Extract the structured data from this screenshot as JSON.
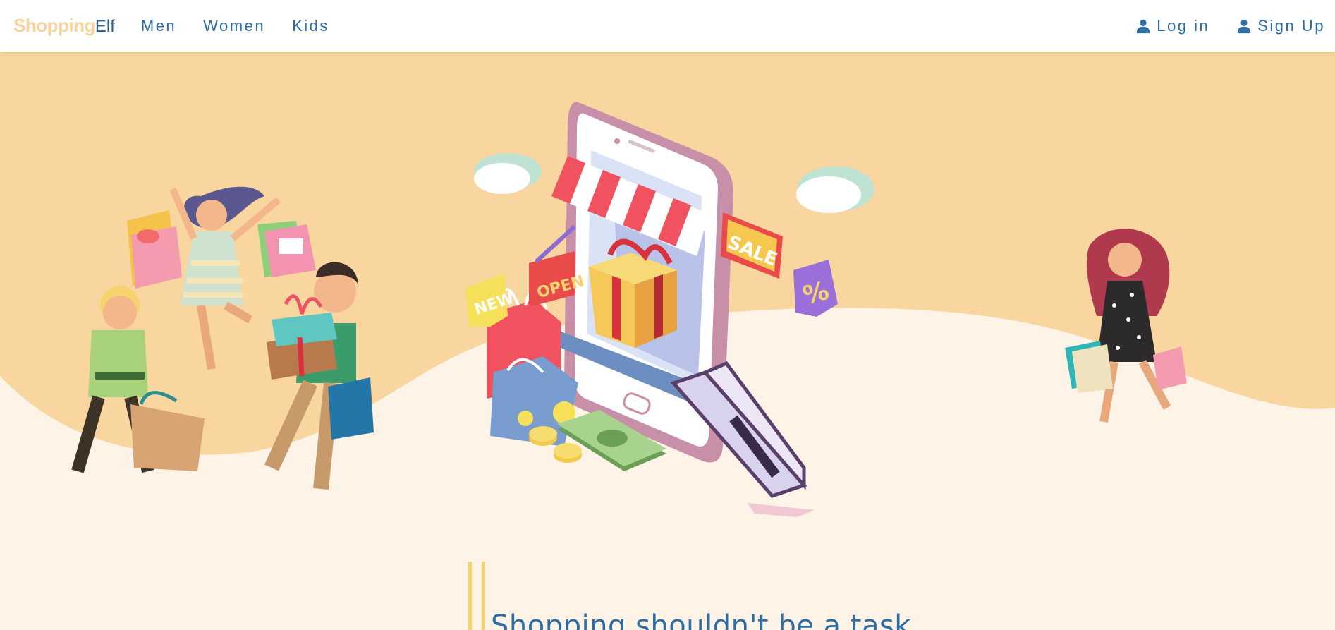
{
  "navbar": {
    "brand_primary": "Shopping",
    "brand_secondary": "Elf",
    "links": [
      {
        "label": "Men"
      },
      {
        "label": "Women"
      },
      {
        "label": "Kids"
      }
    ],
    "login_label": "Log in",
    "signup_label": "Sign Up",
    "user_icon": "user-icon"
  },
  "hero": {
    "illustration": "shopping-phone-illustration",
    "signs": {
      "new": "NEW",
      "open": "OPEN",
      "sale": "SALE",
      "percent": "%"
    },
    "tagline": "Shopping shouldn't be a task"
  },
  "colors": {
    "hero_bg": "#f9d59f",
    "ground": "#fdf3e7",
    "brand_accent": "#f8d29b",
    "link": "#2e6da4",
    "tagline_bar": "#f6d36d"
  }
}
